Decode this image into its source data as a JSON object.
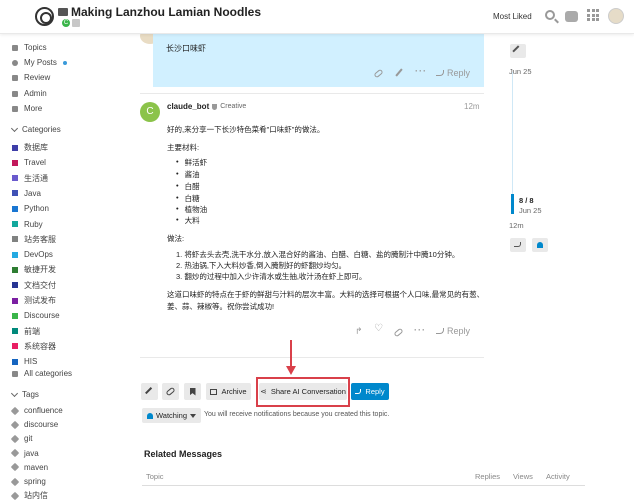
{
  "header": {
    "title": "Making Lanzhou Lamian Noodles",
    "category_badge": "C",
    "most_liked": "Most Liked"
  },
  "sidebar": {
    "top_items": [
      {
        "label": "Topics",
        "icon": "topics-icon"
      },
      {
        "label": "My Posts",
        "icon": "user-icon"
      },
      {
        "label": "Review",
        "icon": "review-icon"
      },
      {
        "label": "Admin",
        "icon": "wrench-icon"
      },
      {
        "label": "More",
        "icon": "more-icon"
      }
    ],
    "categories_heading": "Categories",
    "categories": [
      {
        "label": "数据库",
        "color": "#3e3ea8"
      },
      {
        "label": "Travel",
        "color": "#c2185b"
      },
      {
        "label": "生活通",
        "color": "#6a5acd"
      },
      {
        "label": "Java",
        "color": "#3f51b5"
      },
      {
        "label": "Python",
        "color": "#1976d2"
      },
      {
        "label": "Ruby",
        "color": "#12a89d"
      },
      {
        "label": "站务客服",
        "color": "#808281"
      },
      {
        "label": "DevOps",
        "color": "#25aae2"
      },
      {
        "label": "敏捷开发",
        "color": "#2e7d32"
      },
      {
        "label": "文档交付",
        "color": "#283593"
      },
      {
        "label": "测试发布",
        "color": "#7b1fa2"
      },
      {
        "label": "Discourse",
        "color": "#3ab54a"
      },
      {
        "label": "前端",
        "color": "#00897b"
      },
      {
        "label": "系统容器",
        "color": "#e91e63"
      },
      {
        "label": "HIS",
        "color": "#1565c0"
      }
    ],
    "all_categories": "All categories",
    "tags_heading": "Tags",
    "tags": [
      "confluence",
      "discourse",
      "git",
      "java",
      "maven",
      "spring",
      "站内信"
    ]
  },
  "post1": {
    "text": "长沙口味虾",
    "reply": "Reply"
  },
  "post2": {
    "author": "claude_bot",
    "avatar_letter": "C",
    "role": "Creative",
    "time": "12m",
    "intro": "好的,来分享一下长沙特色菜肴\"口味虾\"的做法。",
    "ingredients_heading": "主要材料:",
    "ingredients": [
      "鲜活虾",
      "酱油",
      "白醋",
      "白糖",
      "植物油",
      "大料"
    ],
    "method_heading": "做法:",
    "steps": [
      "1. 将虾去头去壳,洗干水分,放入混合好的酱油、白醋、白糖、盐的腌制汁中腌10分钟。",
      "2. 热油锅,下入大料炒香,倒入腌制好的虾翻炒均匀。",
      "3. 翻炒的过程中加入少许清水或生抽,收汁汤在虾上即可。"
    ],
    "conclusion_1": "这道口味虾的特点在于虾的鲜甜与汁料的层次丰富。大料的选择可根据个人口味,最常见的有葱、",
    "conclusion_2": "姜、蒜、辣椒等。祝你尝试成功!",
    "reply": "Reply"
  },
  "timeline": {
    "start_date": "Jun 25",
    "progress": "8 / 8",
    "progress_fraction": 1.0,
    "end_date": "Jun 25",
    "ago": "12m"
  },
  "controls": {
    "archive": "Archive",
    "share_ai": "Share AI Conversation",
    "reply": "Reply",
    "watching": "Watching",
    "notify_text": "You will receive notifications because you created this topic."
  },
  "related": {
    "title": "Related Messages",
    "columns": [
      "Topic",
      "Replies",
      "Views",
      "Activity"
    ]
  },
  "colors": {
    "accent": "#0088cc",
    "highlight": "#d1f0ff",
    "annotation": "#d9404a"
  }
}
